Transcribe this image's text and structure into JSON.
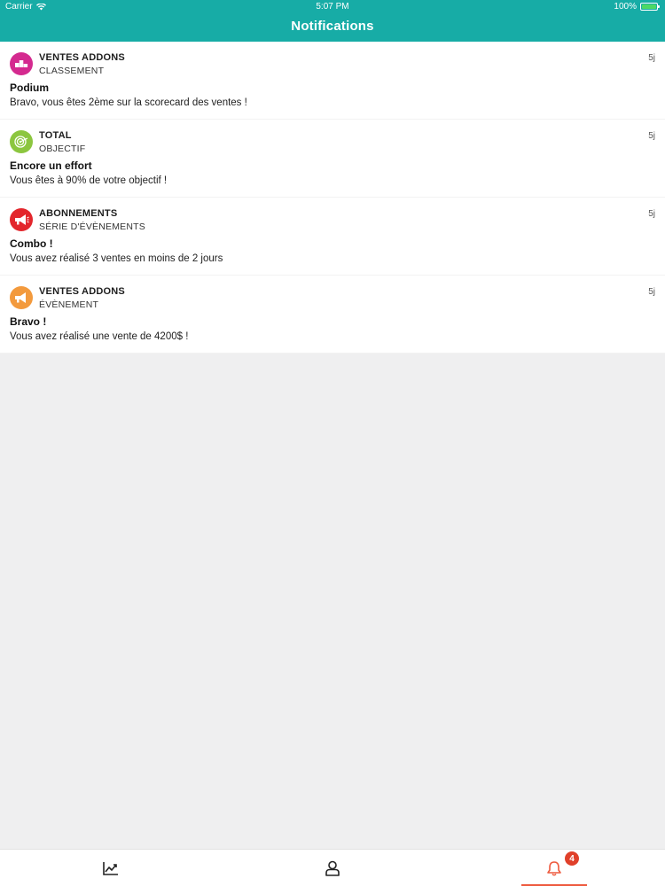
{
  "status_bar": {
    "carrier": "Carrier",
    "time": "5:07 PM",
    "battery": "100%"
  },
  "header": {
    "title": "Notifications"
  },
  "notifications": [
    {
      "category": "VENTES ADDONS",
      "type": "CLASSEMENT",
      "time": "5j",
      "title": "Podium",
      "message": "Bravo, vous êtes 2ème sur la scorecard des ventes !",
      "icon": "podium-icon",
      "icon_color": "#d42a8f"
    },
    {
      "category": "TOTAL",
      "type": "OBJECTIF",
      "time": "5j",
      "title": "Encore un effort",
      "message": "Vous êtes à 90% de votre objectif !",
      "icon": "target-icon",
      "icon_color": "#8cc63f"
    },
    {
      "category": "ABONNEMENTS",
      "type": "SÉRIE D'ÉVÈNEMENTS",
      "time": "5j",
      "title": "Combo !",
      "message": "Vous avez réalisé 3 ventes en moins de 2 jours",
      "icon": "megaphone-icon",
      "icon_color": "#e3262c"
    },
    {
      "category": "VENTES ADDONS",
      "type": "ÉVÈNEMENT",
      "time": "5j",
      "title": "Bravo !",
      "message": "Vous avez réalisé une vente de 4200$ !",
      "icon": "megaphone-icon",
      "icon_color": "#f39a3d"
    }
  ],
  "tabbar": {
    "items": [
      {
        "name": "stats",
        "icon": "chart-line-icon"
      },
      {
        "name": "profile",
        "icon": "user-icon"
      },
      {
        "name": "notifications",
        "icon": "bell-icon",
        "badge": "4",
        "active": true
      }
    ],
    "active_color": "#ee5a3e"
  }
}
